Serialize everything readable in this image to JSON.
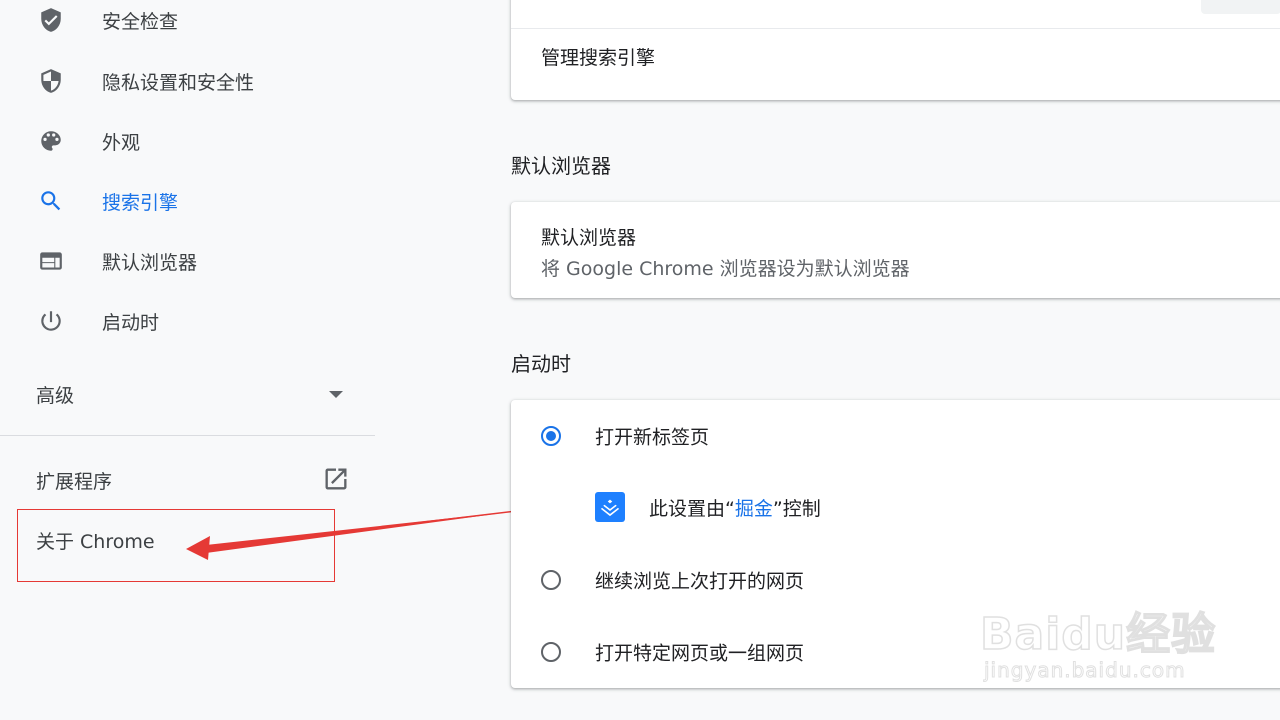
{
  "sidebar": {
    "items": [
      {
        "label": "安全检查",
        "icon": "shield-check-icon"
      },
      {
        "label": "隐私设置和安全性",
        "icon": "shield-icon"
      },
      {
        "label": "外观",
        "icon": "palette-icon"
      },
      {
        "label": "搜索引擎",
        "icon": "search-icon",
        "active": true
      },
      {
        "label": "默认浏览器",
        "icon": "browser-window-icon"
      },
      {
        "label": "启动时",
        "icon": "power-icon"
      }
    ],
    "advanced_label": "高级",
    "extensions_label": "扩展程序",
    "about_label": "关于 Chrome"
  },
  "main": {
    "search_engine_card": {
      "manage_label": "管理搜索引擎"
    },
    "default_browser": {
      "section_title": "默认浏览器",
      "card_title": "默认浏览器",
      "card_subtitle": "将 Google Chrome 浏览器设为默认浏览器"
    },
    "on_startup": {
      "section_title": "启动时",
      "options": [
        {
          "label": "打开新标签页",
          "checked": true
        },
        {
          "label": "继续浏览上次打开的网页",
          "checked": false
        },
        {
          "label": "打开特定网页或一组网页",
          "checked": false
        }
      ],
      "policy_prefix": "此设置由“",
      "policy_link": "掘金",
      "policy_suffix": "”控制"
    }
  },
  "watermark": {
    "main": "Baidu经验",
    "sub": "jingyan.baidu.com"
  },
  "colors": {
    "accent": "#1a73e8",
    "annotation_red": "#e53935",
    "background": "#f8f9fa"
  }
}
